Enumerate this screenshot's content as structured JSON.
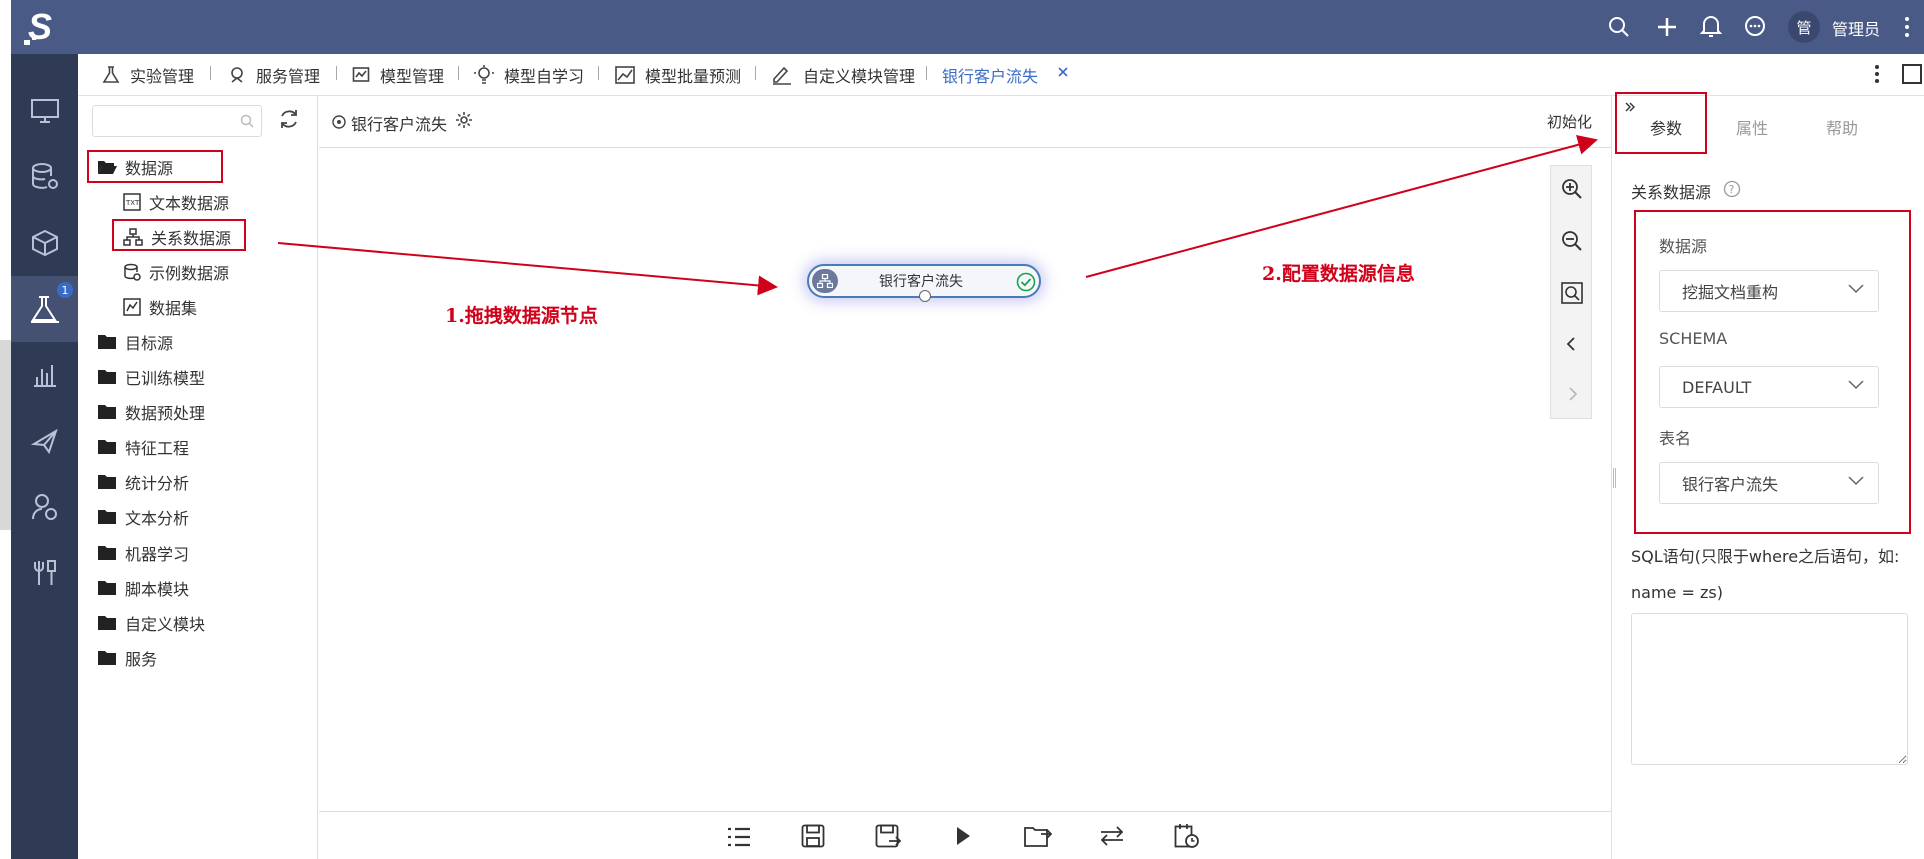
{
  "app": {
    "logo": "S",
    "avatar_char": "管",
    "user_name": "管理员"
  },
  "tabs": [
    {
      "label": "实验管理",
      "icon": "flask-icon"
    },
    {
      "label": "服务管理",
      "icon": "service-icon"
    },
    {
      "label": "模型管理",
      "icon": "model-icon"
    },
    {
      "label": "模型自学习",
      "icon": "bulb-icon"
    },
    {
      "label": "模型批量预测",
      "icon": "chart-icon"
    },
    {
      "label": "自定义模块管理",
      "icon": "edit-icon"
    },
    {
      "label": "银行客户流失",
      "active": true
    }
  ],
  "sidenav": {
    "badge": "1"
  },
  "tree": {
    "search_placeholder": "",
    "items": [
      {
        "label": "数据源"
      },
      {
        "label": "文本数据源"
      },
      {
        "label": "关系数据源"
      },
      {
        "label": "示例数据源"
      },
      {
        "label": "数据集"
      },
      {
        "label": "目标源"
      },
      {
        "label": "已训练模型"
      },
      {
        "label": "数据预处理"
      },
      {
        "label": "特征工程"
      },
      {
        "label": "统计分析"
      },
      {
        "label": "文本分析"
      },
      {
        "label": "机器学习"
      },
      {
        "label": "脚本模块"
      },
      {
        "label": "自定义模块"
      },
      {
        "label": "服务"
      }
    ]
  },
  "canvas": {
    "title": "银行客户流失",
    "init_label": "初始化",
    "node_label": "银行客户流失",
    "annotation1": "1.拖拽数据源节点",
    "annotation2": "2.配置数据源信息"
  },
  "right_panel": {
    "tabs": [
      "参数",
      "属性",
      "帮助"
    ],
    "section_label": "关系数据源",
    "datasource_label": "数据源",
    "datasource_value": "挖掘文档重构",
    "schema_label": "SCHEMA",
    "schema_value": "DEFAULT",
    "table_label": "表名",
    "table_value": "银行客户流失",
    "sql_label_line1": "SQL语句(只限于where之后语句，如:",
    "sql_label_line2": "name = zs)",
    "sql_value": ""
  },
  "colors": {
    "topbar": "#4a5a87",
    "sidenav": "#2f3a55",
    "annotation": "#d0021b",
    "accent": "#3b6cc5"
  }
}
